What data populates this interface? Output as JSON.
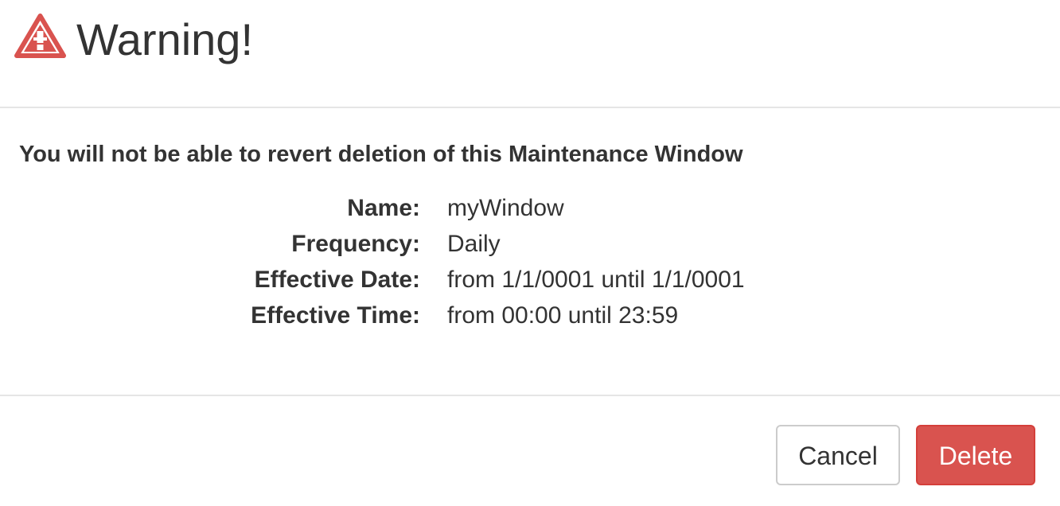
{
  "dialog": {
    "title": "Warning!",
    "icon": "warning-triangle-icon",
    "message": "You will not be able to revert deletion of this Maintenance Window",
    "details": [
      {
        "label": "Name:",
        "value": "myWindow"
      },
      {
        "label": "Frequency:",
        "value": "Daily"
      },
      {
        "label": "Effective Date:",
        "value": "from 1/1/0001 until 1/1/0001"
      },
      {
        "label": "Effective Time:",
        "value": "from 00:00 until 23:59"
      }
    ],
    "cancel_label": "Cancel",
    "delete_label": "Delete"
  },
  "colors": {
    "warning": "#d9534f",
    "danger_button": "#d9534f",
    "text": "#333333",
    "divider": "#e5e5e5"
  }
}
